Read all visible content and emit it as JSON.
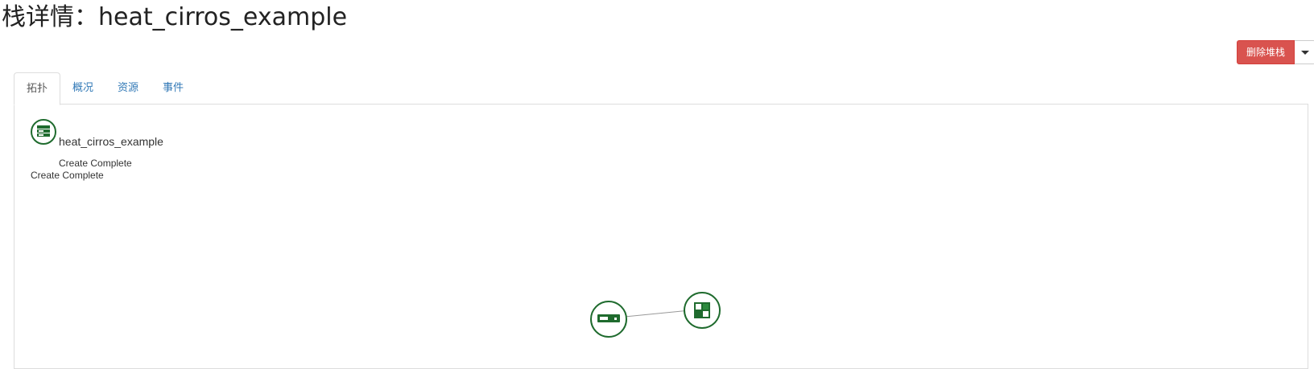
{
  "page": {
    "title": "栈详情：heat_cirros_example"
  },
  "actions": {
    "delete_stack_label": "删除堆栈"
  },
  "tabs": [
    {
      "label": "拓扑",
      "active": true
    },
    {
      "label": "概况",
      "active": false
    },
    {
      "label": "资源",
      "active": false
    },
    {
      "label": "事件",
      "active": false
    }
  ],
  "topology": {
    "stack": {
      "name": "heat_cirros_example",
      "status": "Create Complete",
      "status_secondary": "Create Complete",
      "icon": "stack-server-icon"
    },
    "nodes": [
      {
        "icon": "server-icon"
      },
      {
        "icon": "image-icon"
      }
    ],
    "colors": {
      "node_stroke": "#1f6b2e",
      "link": "#999999",
      "danger": "#d9534f",
      "tab_link": "#337ab7"
    }
  }
}
